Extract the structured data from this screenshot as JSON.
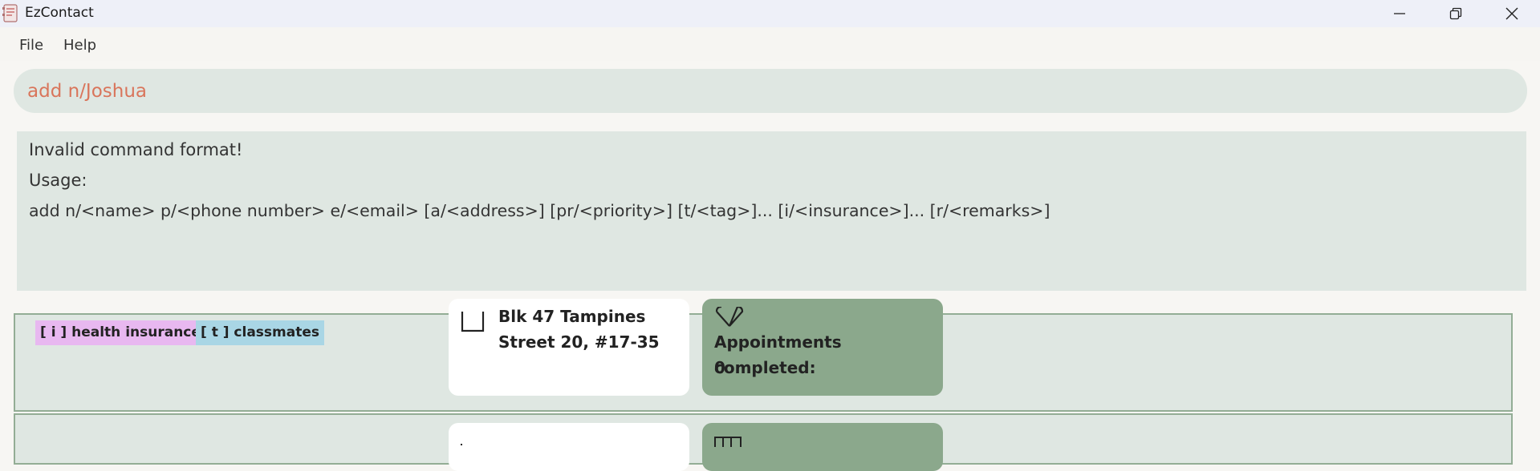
{
  "window": {
    "title": "EzContact",
    "controls": [
      "minimize",
      "restore",
      "close"
    ]
  },
  "menu": {
    "file": "File",
    "help": "Help"
  },
  "command": {
    "value": "add n/Joshua"
  },
  "result": {
    "line1": "Invalid command format!",
    "line2": "Usage:",
    "line3": "add n/<name> p/<phone number> e/<email> [a/<address>] [pr/<priority>] [t/<tag>]... [i/<insurance>]... [r/<remarks>]"
  },
  "person_card": {
    "tags": [
      {
        "label": "[ i ] health insurance",
        "color": "#e8b8f0"
      },
      {
        "label": "[ t ] classmates",
        "color": "#a9d6e5"
      }
    ],
    "address_line1": "Blk 47 Tampines",
    "address_line2": "Street 20, #17-35",
    "appointments_label": "Appointments completed:",
    "appointments_value": "0"
  },
  "colors": {
    "accent_text": "#d9755b",
    "panel_bg": "#dfe7e2",
    "green_panel": "#8ba88c",
    "card_border": "#93ad95"
  }
}
